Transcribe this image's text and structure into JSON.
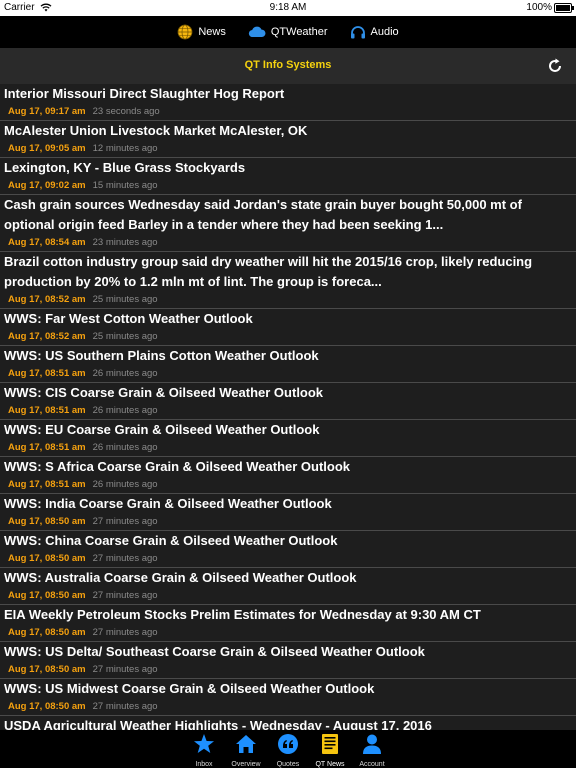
{
  "status_bar": {
    "carrier": "Carrier",
    "time": "9:18 AM",
    "battery": "100%"
  },
  "top_nav": {
    "items": [
      {
        "label": "News",
        "icon": "globe-icon"
      },
      {
        "label": "QTWeather",
        "icon": "cloud-icon"
      },
      {
        "label": "Audio",
        "icon": "headphones-icon"
      }
    ]
  },
  "header": {
    "title": "QT Info Systems",
    "refresh_icon": "refresh-icon"
  },
  "news": [
    {
      "title": "Interior Missouri Direct Slaughter Hog Report",
      "date": "Aug 17, 09:17 am",
      "ago": "23 seconds ago"
    },
    {
      "title": "McAlester Union Livestock Market McAlester, OK",
      "date": "Aug 17, 09:05 am",
      "ago": "12 minutes ago"
    },
    {
      "title": "Lexington, KY - Blue Grass Stockyards",
      "date": "Aug 17, 09:02 am",
      "ago": "15 minutes ago"
    },
    {
      "title": "Cash grain sources Wednesday said Jordan's state grain buyer bought 50,000 mt of optional origin feed Barley in a tender where they had been seeking 1...",
      "date": "Aug 17, 08:54 am",
      "ago": "23 minutes ago"
    },
    {
      "title": "Brazil cotton industry group said dry weather will hit the 2015/16 crop, likely reducing production by 20% to 1.2 mln mt of lint. The group is foreca...",
      "date": "Aug 17, 08:52 am",
      "ago": "25 minutes ago"
    },
    {
      "title": "WWS: Far West Cotton Weather Outlook",
      "date": "Aug 17, 08:52 am",
      "ago": "25 minutes ago"
    },
    {
      "title": "WWS: US Southern Plains Cotton Weather Outlook",
      "date": "Aug 17, 08:51 am",
      "ago": "26 minutes ago"
    },
    {
      "title": "WWS: CIS Coarse Grain & Oilseed Weather Outlook",
      "date": "Aug 17, 08:51 am",
      "ago": "26 minutes ago"
    },
    {
      "title": "WWS: EU Coarse Grain & Oilseed Weather Outlook",
      "date": "Aug 17, 08:51 am",
      "ago": "26 minutes ago"
    },
    {
      "title": "WWS: S Africa Coarse Grain & Oilseed Weather Outlook",
      "date": "Aug 17, 08:51 am",
      "ago": "26 minutes ago"
    },
    {
      "title": "WWS: India Coarse Grain & Oilseed Weather Outlook",
      "date": "Aug 17, 08:50 am",
      "ago": "27 minutes ago"
    },
    {
      "title": "WWS: China Coarse Grain & Oilseed Weather Outlook",
      "date": "Aug 17, 08:50 am",
      "ago": "27 minutes ago"
    },
    {
      "title": "WWS: Australia Coarse Grain & Oilseed Weather Outlook",
      "date": "Aug 17, 08:50 am",
      "ago": "27 minutes ago"
    },
    {
      "title": "EIA Weekly Petroleum Stocks Prelim Estimates for Wednesday at 9:30 AM CT",
      "date": "Aug 17, 08:50 am",
      "ago": "27 minutes ago"
    },
    {
      "title": "WWS: US Delta/ Southeast Coarse Grain & Oilseed Weather Outlook",
      "date": "Aug 17, 08:50 am",
      "ago": "27 minutes ago"
    },
    {
      "title": "WWS: US Midwest Coarse Grain & Oilseed Weather Outlook",
      "date": "Aug 17, 08:50 am",
      "ago": "27 minutes ago"
    },
    {
      "title": "USDA Agricultural Weather Highlights - Wednesday - August 17, 2016",
      "date": "",
      "ago": ""
    }
  ],
  "tab_bar": {
    "items": [
      {
        "label": "Inbox",
        "icon": "star-icon"
      },
      {
        "label": "Overview",
        "icon": "home-icon"
      },
      {
        "label": "Quotes",
        "icon": "quote-icon"
      },
      {
        "label": "QT News",
        "icon": "news-document-icon",
        "active": true
      },
      {
        "label": "Account",
        "icon": "person-icon"
      }
    ]
  },
  "colors": {
    "accent_yellow": "#f5d20f",
    "date_orange": "#f5a10f",
    "tab_blue": "#1e90ff"
  }
}
